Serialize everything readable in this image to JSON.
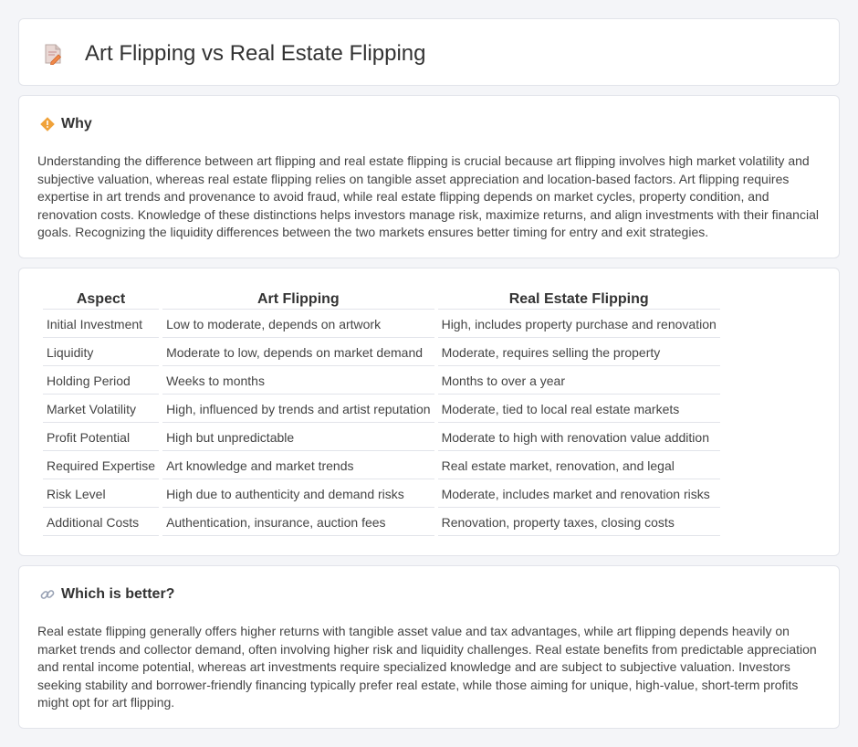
{
  "header": {
    "title": "Art Flipping vs Real Estate Flipping",
    "icon": "document-pencil-icon"
  },
  "why": {
    "heading": "Why",
    "icon": "diamond-warning-icon",
    "text": "Understanding the difference between art flipping and real estate flipping is crucial because art flipping involves high market volatility and subjective valuation, whereas real estate flipping relies on tangible asset appreciation and location-based factors. Art flipping requires expertise in art trends and provenance to avoid fraud, while real estate flipping depends on market cycles, property condition, and renovation costs. Knowledge of these distinctions helps investors manage risk, maximize returns, and align investments with their financial goals. Recognizing the liquidity differences between the two markets ensures better timing for entry and exit strategies."
  },
  "comparison": {
    "columns": [
      "Aspect",
      "Art Flipping",
      "Real Estate Flipping"
    ],
    "rows": [
      [
        "Initial Investment",
        "Low to moderate, depends on artwork",
        "High, includes property purchase and renovation"
      ],
      [
        "Liquidity",
        "Moderate to low, depends on market demand",
        "Moderate, requires selling the property"
      ],
      [
        "Holding Period",
        "Weeks to months",
        "Months to over a year"
      ],
      [
        "Market Volatility",
        "High, influenced by trends and artist reputation",
        "Moderate, tied to local real estate markets"
      ],
      [
        "Profit Potential",
        "High but unpredictable",
        "Moderate to high with renovation value addition"
      ],
      [
        "Required Expertise",
        "Art knowledge and market trends",
        "Real estate market, renovation, and legal"
      ],
      [
        "Risk Level",
        "High due to authenticity and demand risks",
        "Moderate, includes market and renovation risks"
      ],
      [
        "Additional Costs",
        "Authentication, insurance, auction fees",
        "Renovation, property taxes, closing costs"
      ]
    ]
  },
  "better": {
    "heading": "Which is better?",
    "icon": "link-icon",
    "text": "Real estate flipping generally offers higher returns with tangible asset value and tax advantages, while art flipping depends heavily on market trends and collector demand, often involving higher risk and liquidity challenges. Real estate benefits from predictable appreciation and rental income potential, whereas art investments require specialized knowledge and are subject to subjective valuation. Investors seeking stability and borrower-friendly financing typically prefer real estate, while those aiming for unique, high-value, short-term profits might opt for art flipping."
  },
  "colors": {
    "accent": "#f0a23a",
    "background": "#f4f5f8",
    "card": "#ffffff"
  }
}
